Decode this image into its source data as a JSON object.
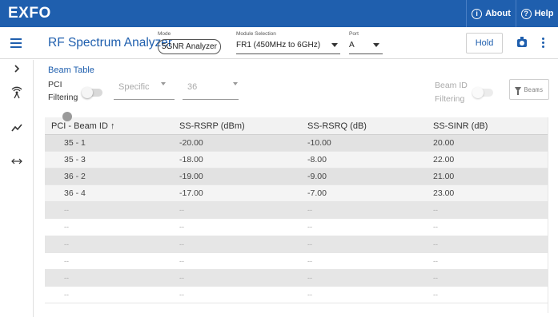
{
  "brand": {
    "logo": "EXFO"
  },
  "topbar": {
    "about_label": "About",
    "help_label": "Help"
  },
  "toolbar": {
    "title": "RF Spectrum Analyzer",
    "mode_label": "Mode",
    "mode_value": "5GNR Analyzer",
    "module_label": "Module Selection",
    "module_value": "FR1 (450MHz to 6GHz)",
    "port_label": "Port",
    "port_value": "A",
    "hold_label": "Hold"
  },
  "rail": {
    "icons": [
      "chevron-right-icon",
      "antenna-icon",
      "trend-icon",
      "swap-horizontal-icon"
    ]
  },
  "beam_table": {
    "title": "Beam Table",
    "pci_filter_label_1": "PCI",
    "pci_filter_label_2": "Filtering",
    "pci_filter_mode": "Specific",
    "pci_filter_value": "36",
    "beamid_filter_label_1": "Beam ID",
    "beamid_filter_label_2": "Filtering",
    "beams_button_label": "Beams",
    "columns": [
      "PCI - Beam ID",
      "SS-RSRP (dBm)",
      "SS-RSRQ (dB)",
      "SS-SINR (dB)"
    ],
    "sort_indicator": "↑",
    "rows": [
      [
        "35 - 1",
        "-20.00",
        "-10.00",
        "20.00"
      ],
      [
        "35 - 3",
        "-18.00",
        "-8.00",
        "22.00"
      ],
      [
        "36 - 2",
        "-19.00",
        "-9.00",
        "21.00"
      ],
      [
        "36 - 4",
        "-17.00",
        "-7.00",
        "23.00"
      ],
      [
        "--",
        "--",
        "--",
        "--"
      ],
      [
        "--",
        "--",
        "--",
        "--"
      ],
      [
        "--",
        "--",
        "--",
        "--"
      ],
      [
        "--",
        "--",
        "--",
        "--"
      ],
      [
        "--",
        "--",
        "--",
        "--"
      ],
      [
        "--",
        "--",
        "--",
        "--"
      ]
    ]
  }
}
